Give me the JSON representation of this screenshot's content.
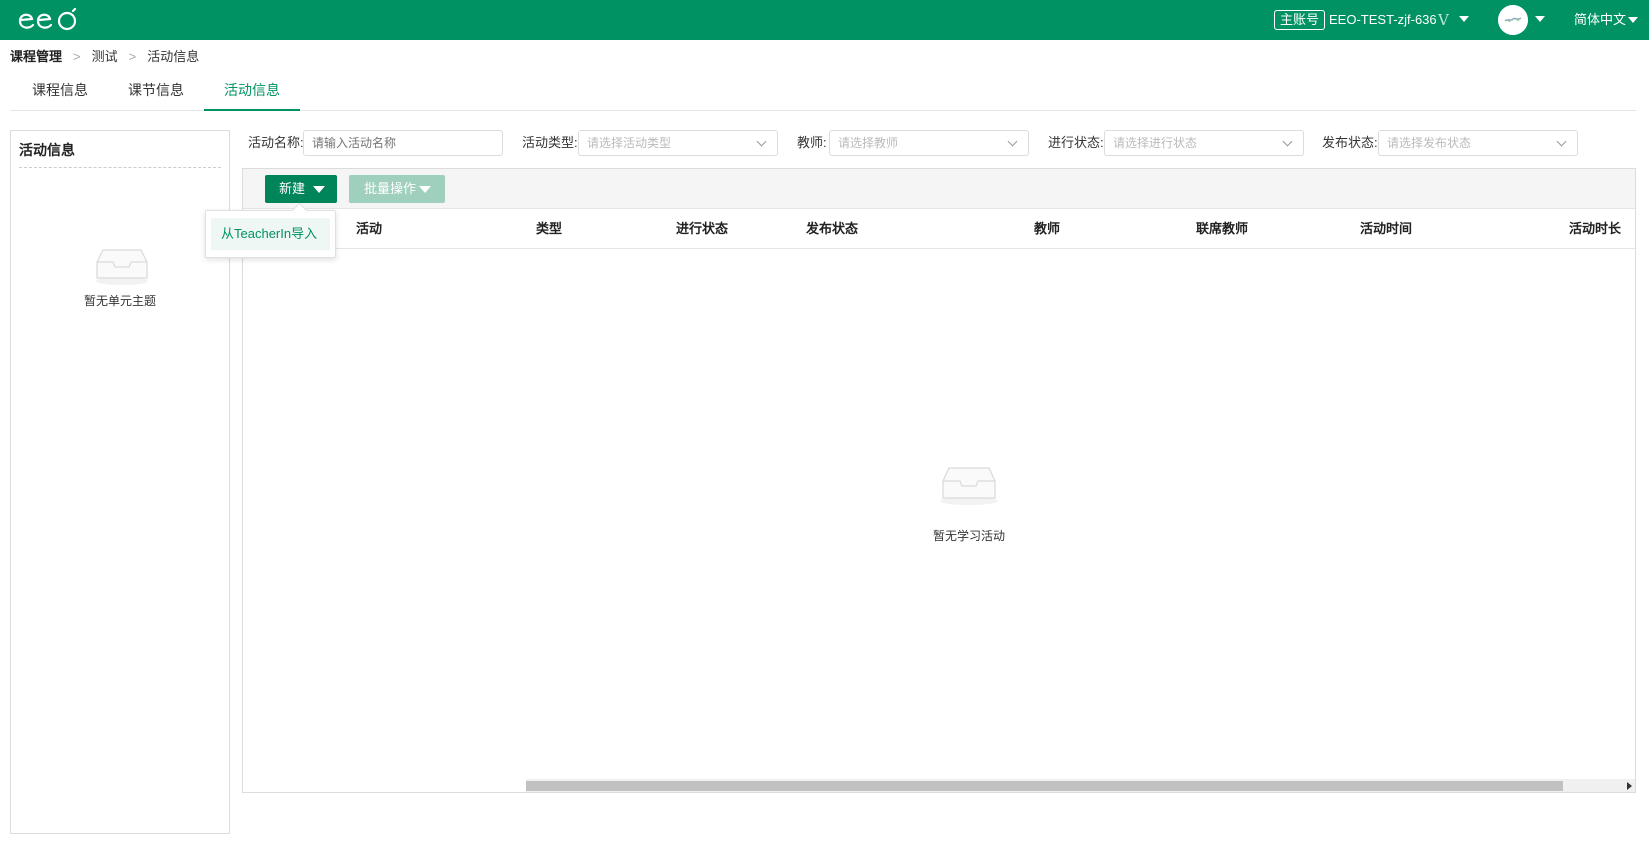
{
  "header": {
    "account_badge": "主账号",
    "account_name": "EEO-TEST-zjf-636",
    "vip_mark": "V",
    "language": "简体中文"
  },
  "breadcrumb": [
    "课程管理",
    "测试",
    "活动信息"
  ],
  "tabs": [
    {
      "label": "课程信息",
      "active": false
    },
    {
      "label": "课节信息",
      "active": false
    },
    {
      "label": "活动信息",
      "active": true
    }
  ],
  "left_panel": {
    "title": "活动信息",
    "empty_text": "暂无单元主题"
  },
  "filters": {
    "activity_name": {
      "label": "活动名称:",
      "placeholder": "请输入活动名称"
    },
    "activity_type": {
      "label": "活动类型:",
      "placeholder": "请选择活动类型"
    },
    "teacher": {
      "label": "教师:",
      "placeholder": "请选择教师"
    },
    "progress_status": {
      "label": "进行状态:",
      "placeholder": "请选择进行状态"
    },
    "publish_status": {
      "label": "发布状态:",
      "placeholder": "请选择发布状态"
    }
  },
  "toolbar": {
    "new_label": "新建",
    "batch_label": "批量操作"
  },
  "dropdown": {
    "import_label": "从TeacherIn导入"
  },
  "table": {
    "columns": [
      "活动",
      "类型",
      "进行状态",
      "发布状态",
      "教师",
      "联席教师",
      "活动时间",
      "活动时长"
    ],
    "empty_text": "暂无学习活动"
  },
  "colors": {
    "brand": "#009262",
    "button_primary": "#00845a",
    "button_disabled": "#9fcfbd"
  }
}
